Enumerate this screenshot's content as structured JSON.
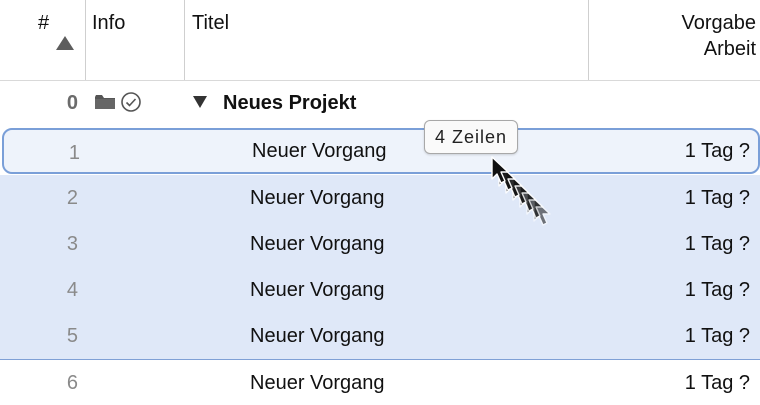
{
  "header": {
    "col_number": "#",
    "col_info": "Info",
    "col_title": "Titel",
    "col_work_line1": "Vorgabe",
    "col_work_line2": "Arbeit"
  },
  "project_row": {
    "number": "0",
    "title": "Neues Projekt",
    "icons": [
      "folder-icon",
      "check-circle-icon"
    ]
  },
  "rows": [
    {
      "number": "1",
      "title": "Neuer Vorgang",
      "work": "1 Tag ?"
    },
    {
      "number": "2",
      "title": "Neuer Vorgang",
      "work": "1 Tag ?"
    },
    {
      "number": "3",
      "title": "Neuer Vorgang",
      "work": "1 Tag ?"
    },
    {
      "number": "4",
      "title": "Neuer Vorgang",
      "work": "1 Tag ?"
    },
    {
      "number": "5",
      "title": "Neuer Vorgang",
      "work": "1 Tag ?"
    },
    {
      "number": "6",
      "title": "Neuer Vorgang",
      "work": "1 Tag ?"
    }
  ],
  "drag": {
    "badge_text": "4 Zeilen",
    "cursor_icon": "arrow-cursor-icon"
  },
  "colors": {
    "selection": "#dfe8f8",
    "selection_border": "#7a9fd8",
    "header_divider": "#cfcfcf"
  }
}
